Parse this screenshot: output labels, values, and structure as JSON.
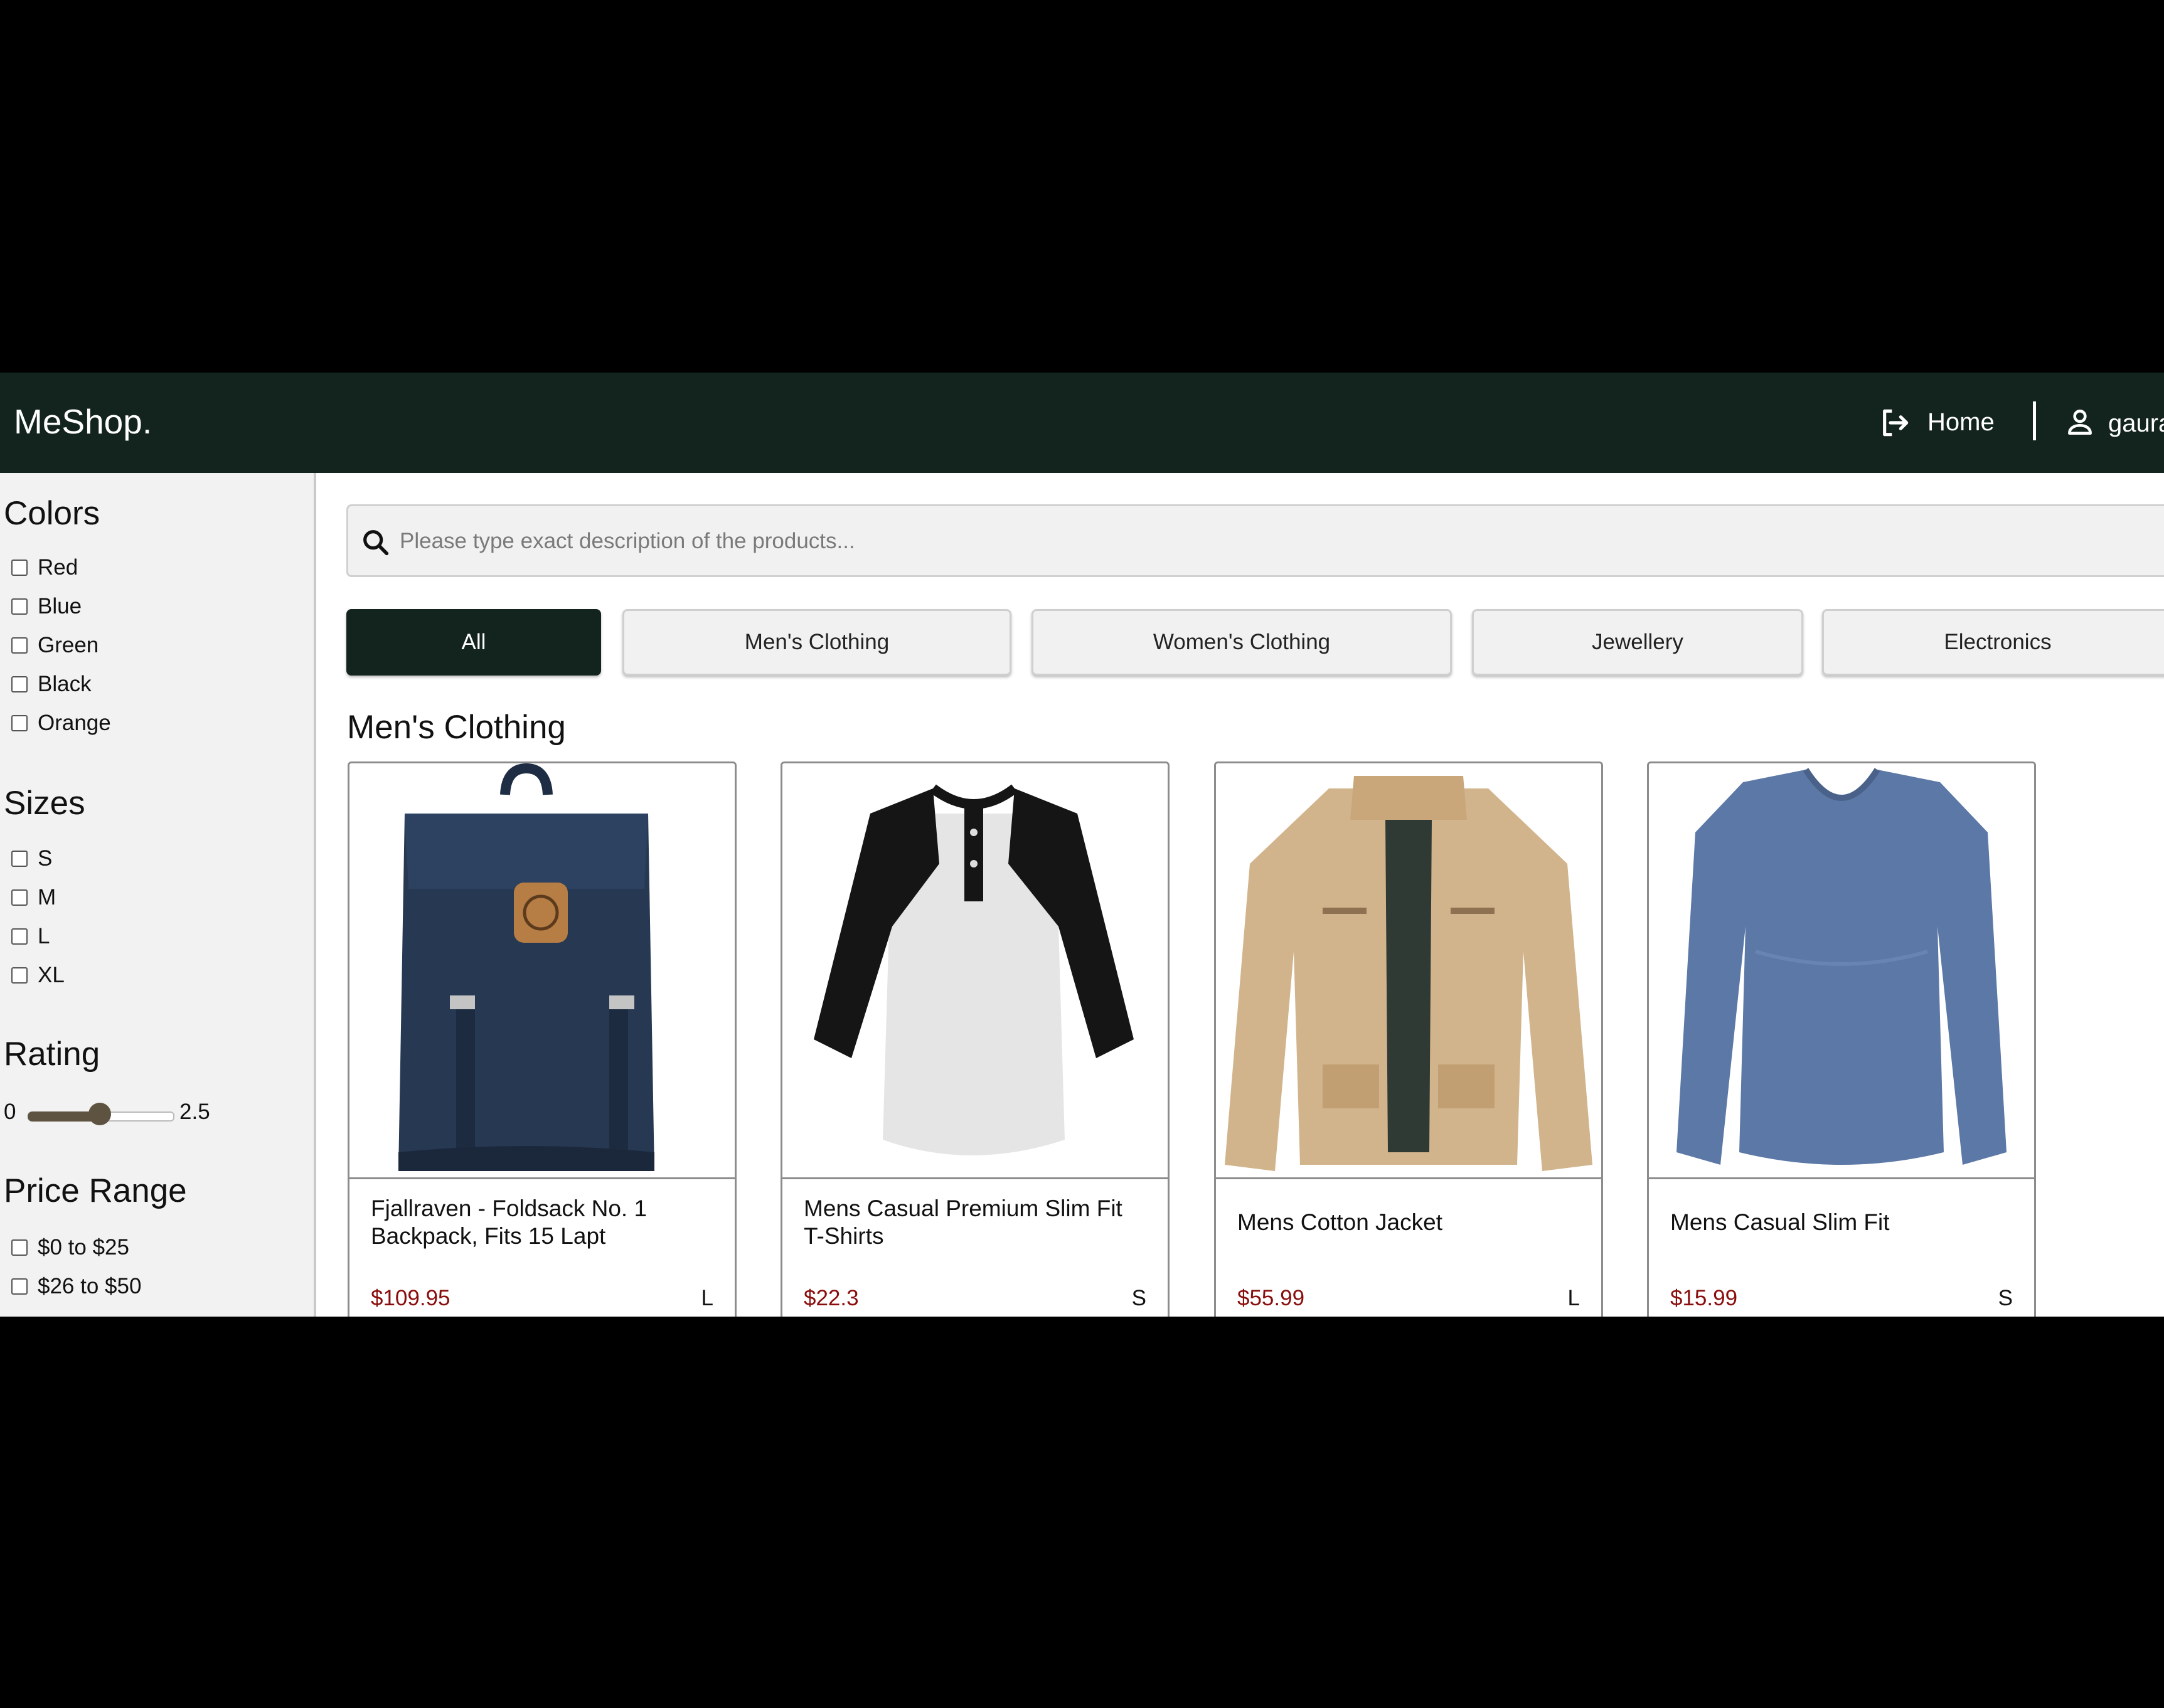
{
  "navbar": {
    "brand": "MeShop.",
    "home_label": "Home",
    "user_name": "gaurav Soni"
  },
  "sidebar": {
    "colors": {
      "title": "Colors",
      "options": [
        "Red",
        "Blue",
        "Green",
        "Black",
        "Orange"
      ]
    },
    "sizes": {
      "title": "Sizes",
      "options": [
        "S",
        "M",
        "L",
        "XL"
      ]
    },
    "rating": {
      "title": "Rating",
      "min_label": "0",
      "value_label": "2.5",
      "fraction": 0.5
    },
    "price": {
      "title": "Price Range",
      "options": [
        "$0 to $25",
        "$26 to $50"
      ]
    }
  },
  "search": {
    "placeholder": "Please type exact description of the products...",
    "value": ""
  },
  "tabs": [
    "All",
    "Men's Clothing",
    "Women's Clothing",
    "Jewellery",
    "Electronics"
  ],
  "active_tab": "All",
  "section_title": "Men's Clothing",
  "products": [
    {
      "title": "Fjallraven - Foldsack No. 1 Backpack, Fits 15 Lapt",
      "price": "$109.95",
      "size": "L",
      "image": "navy backpack"
    },
    {
      "title": "Mens Casual Premium Slim Fit T-Shirts",
      "price": "$22.3",
      "size": "S",
      "image": "raglan henley t-shirt"
    },
    {
      "title": "Mens Cotton Jacket",
      "price": "$55.99",
      "size": "L",
      "image": "khaki cotton jacket"
    },
    {
      "title": "Mens Casual Slim Fit",
      "price": "$15.99",
      "size": "S",
      "image": "blue long-sleeve shirt"
    }
  ],
  "colors": {
    "navbar": "#13241f",
    "price": "#8a0d0d",
    "slider": "#5e5241"
  }
}
